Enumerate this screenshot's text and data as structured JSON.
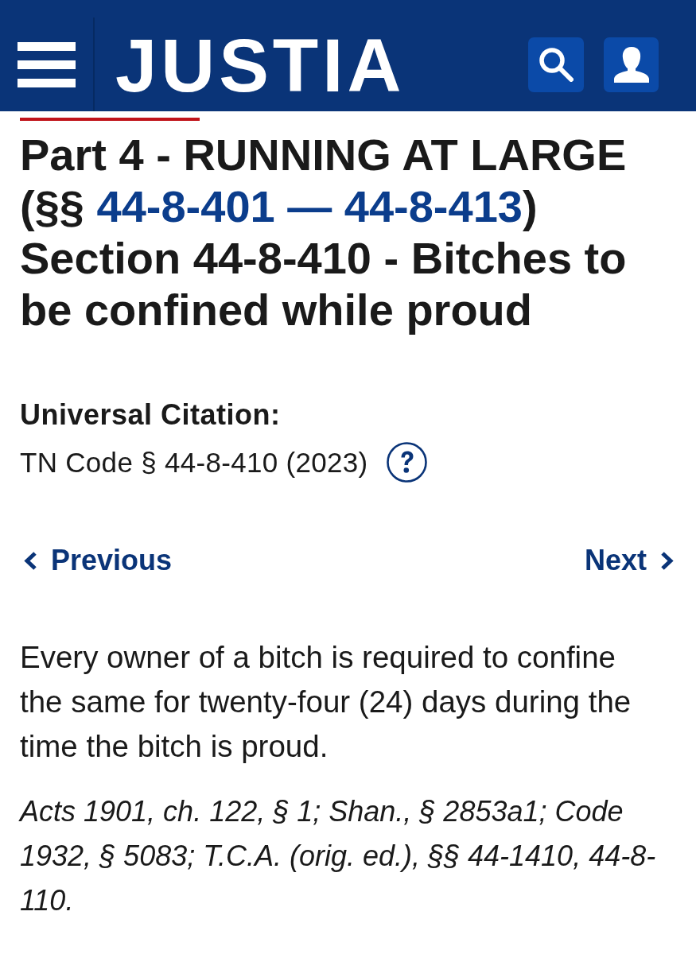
{
  "header": {
    "logo": "JUSTIA"
  },
  "heading": {
    "part_prefix": "Part 4 - RUNNING AT LARGE (§§",
    "part_link": "44-8-401 — 44-8-413",
    "part_suffix": ")",
    "section": "Section 44-8-410 - Bitches to be confined while proud"
  },
  "citation": {
    "label": "Universal Citation:",
    "text": "TN Code § 44-8-410 (2023)"
  },
  "nav": {
    "previous": "Previous",
    "next": "Next"
  },
  "body": [
    "Every owner of a bitch is required to confine the same for twenty-four (24) days during the time the bitch is proud."
  ],
  "history": "Acts 1901, ch. 122, § 1; Shan., § 2853a1; Code 1932, § 5083; T.C.A. (orig. ed.), §§ 44-1410, 44-8-110."
}
